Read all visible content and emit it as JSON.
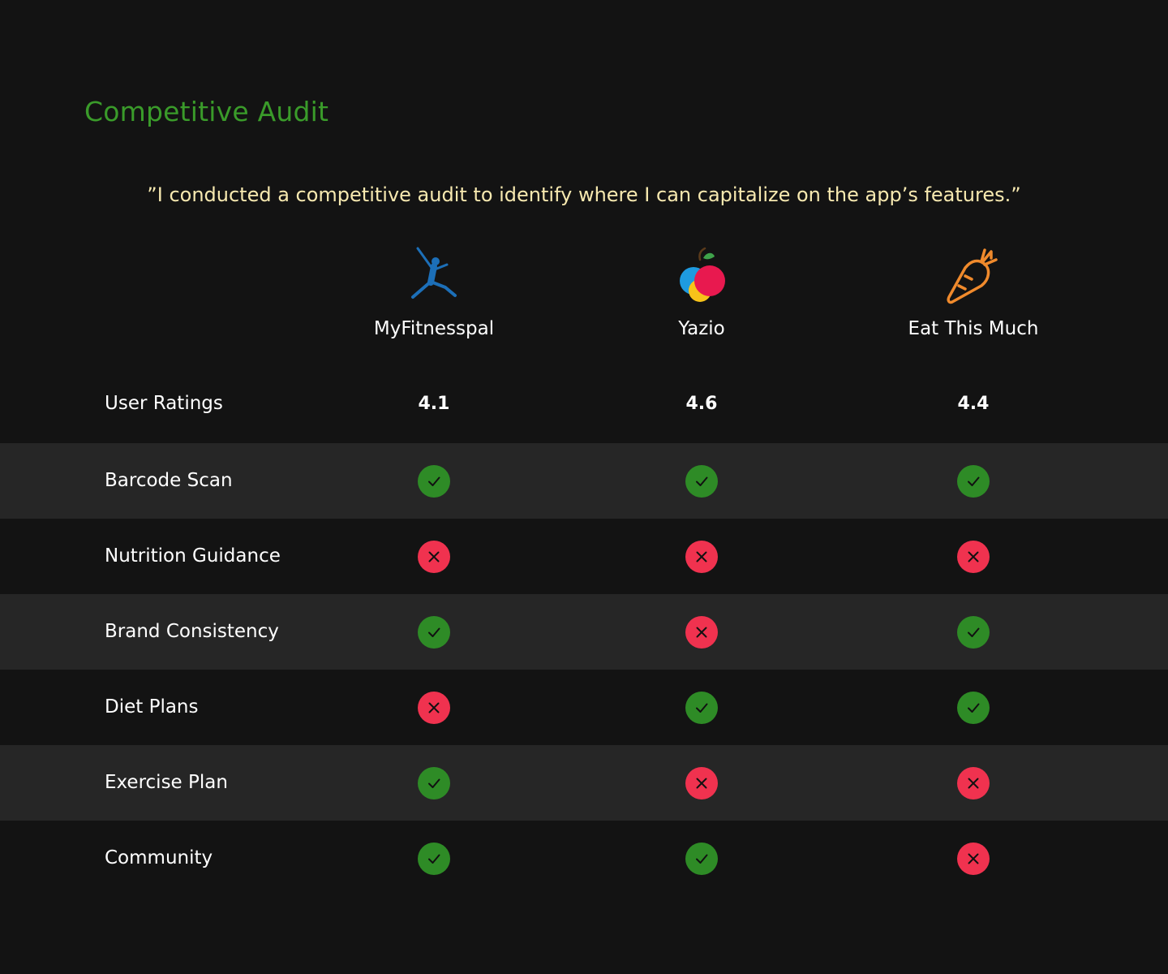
{
  "colors": {
    "background": "#131313",
    "row_alt": "#262626",
    "title": "#3a9b2a",
    "quote": "#f7e9b0",
    "check": "#2e8b26",
    "cross": "#f0324f"
  },
  "title": "Competitive Audit",
  "quote": "”I conducted a competitive audit to identify where I can capitalize on the app’s features.”",
  "apps": [
    {
      "name": "MyFitnesspal",
      "icon": "running-figure-icon"
    },
    {
      "name": "Yazio",
      "icon": "apple-icon"
    },
    {
      "name": "Eat This Much",
      "icon": "carrot-icon"
    }
  ],
  "ratings_row": {
    "label": "User Ratings",
    "values": [
      "4.1",
      "4.6",
      "4.4"
    ]
  },
  "feature_rows": [
    {
      "label": "Barcode Scan",
      "values": [
        true,
        true,
        true
      ]
    },
    {
      "label": "Nutrition Guidance",
      "values": [
        false,
        false,
        false
      ]
    },
    {
      "label": "Brand Consistency",
      "values": [
        true,
        false,
        true
      ]
    },
    {
      "label": "Diet Plans",
      "values": [
        false,
        true,
        true
      ]
    },
    {
      "label": "Exercise Plan",
      "values": [
        true,
        false,
        false
      ]
    },
    {
      "label": "Community",
      "values": [
        true,
        true,
        false
      ]
    }
  ]
}
